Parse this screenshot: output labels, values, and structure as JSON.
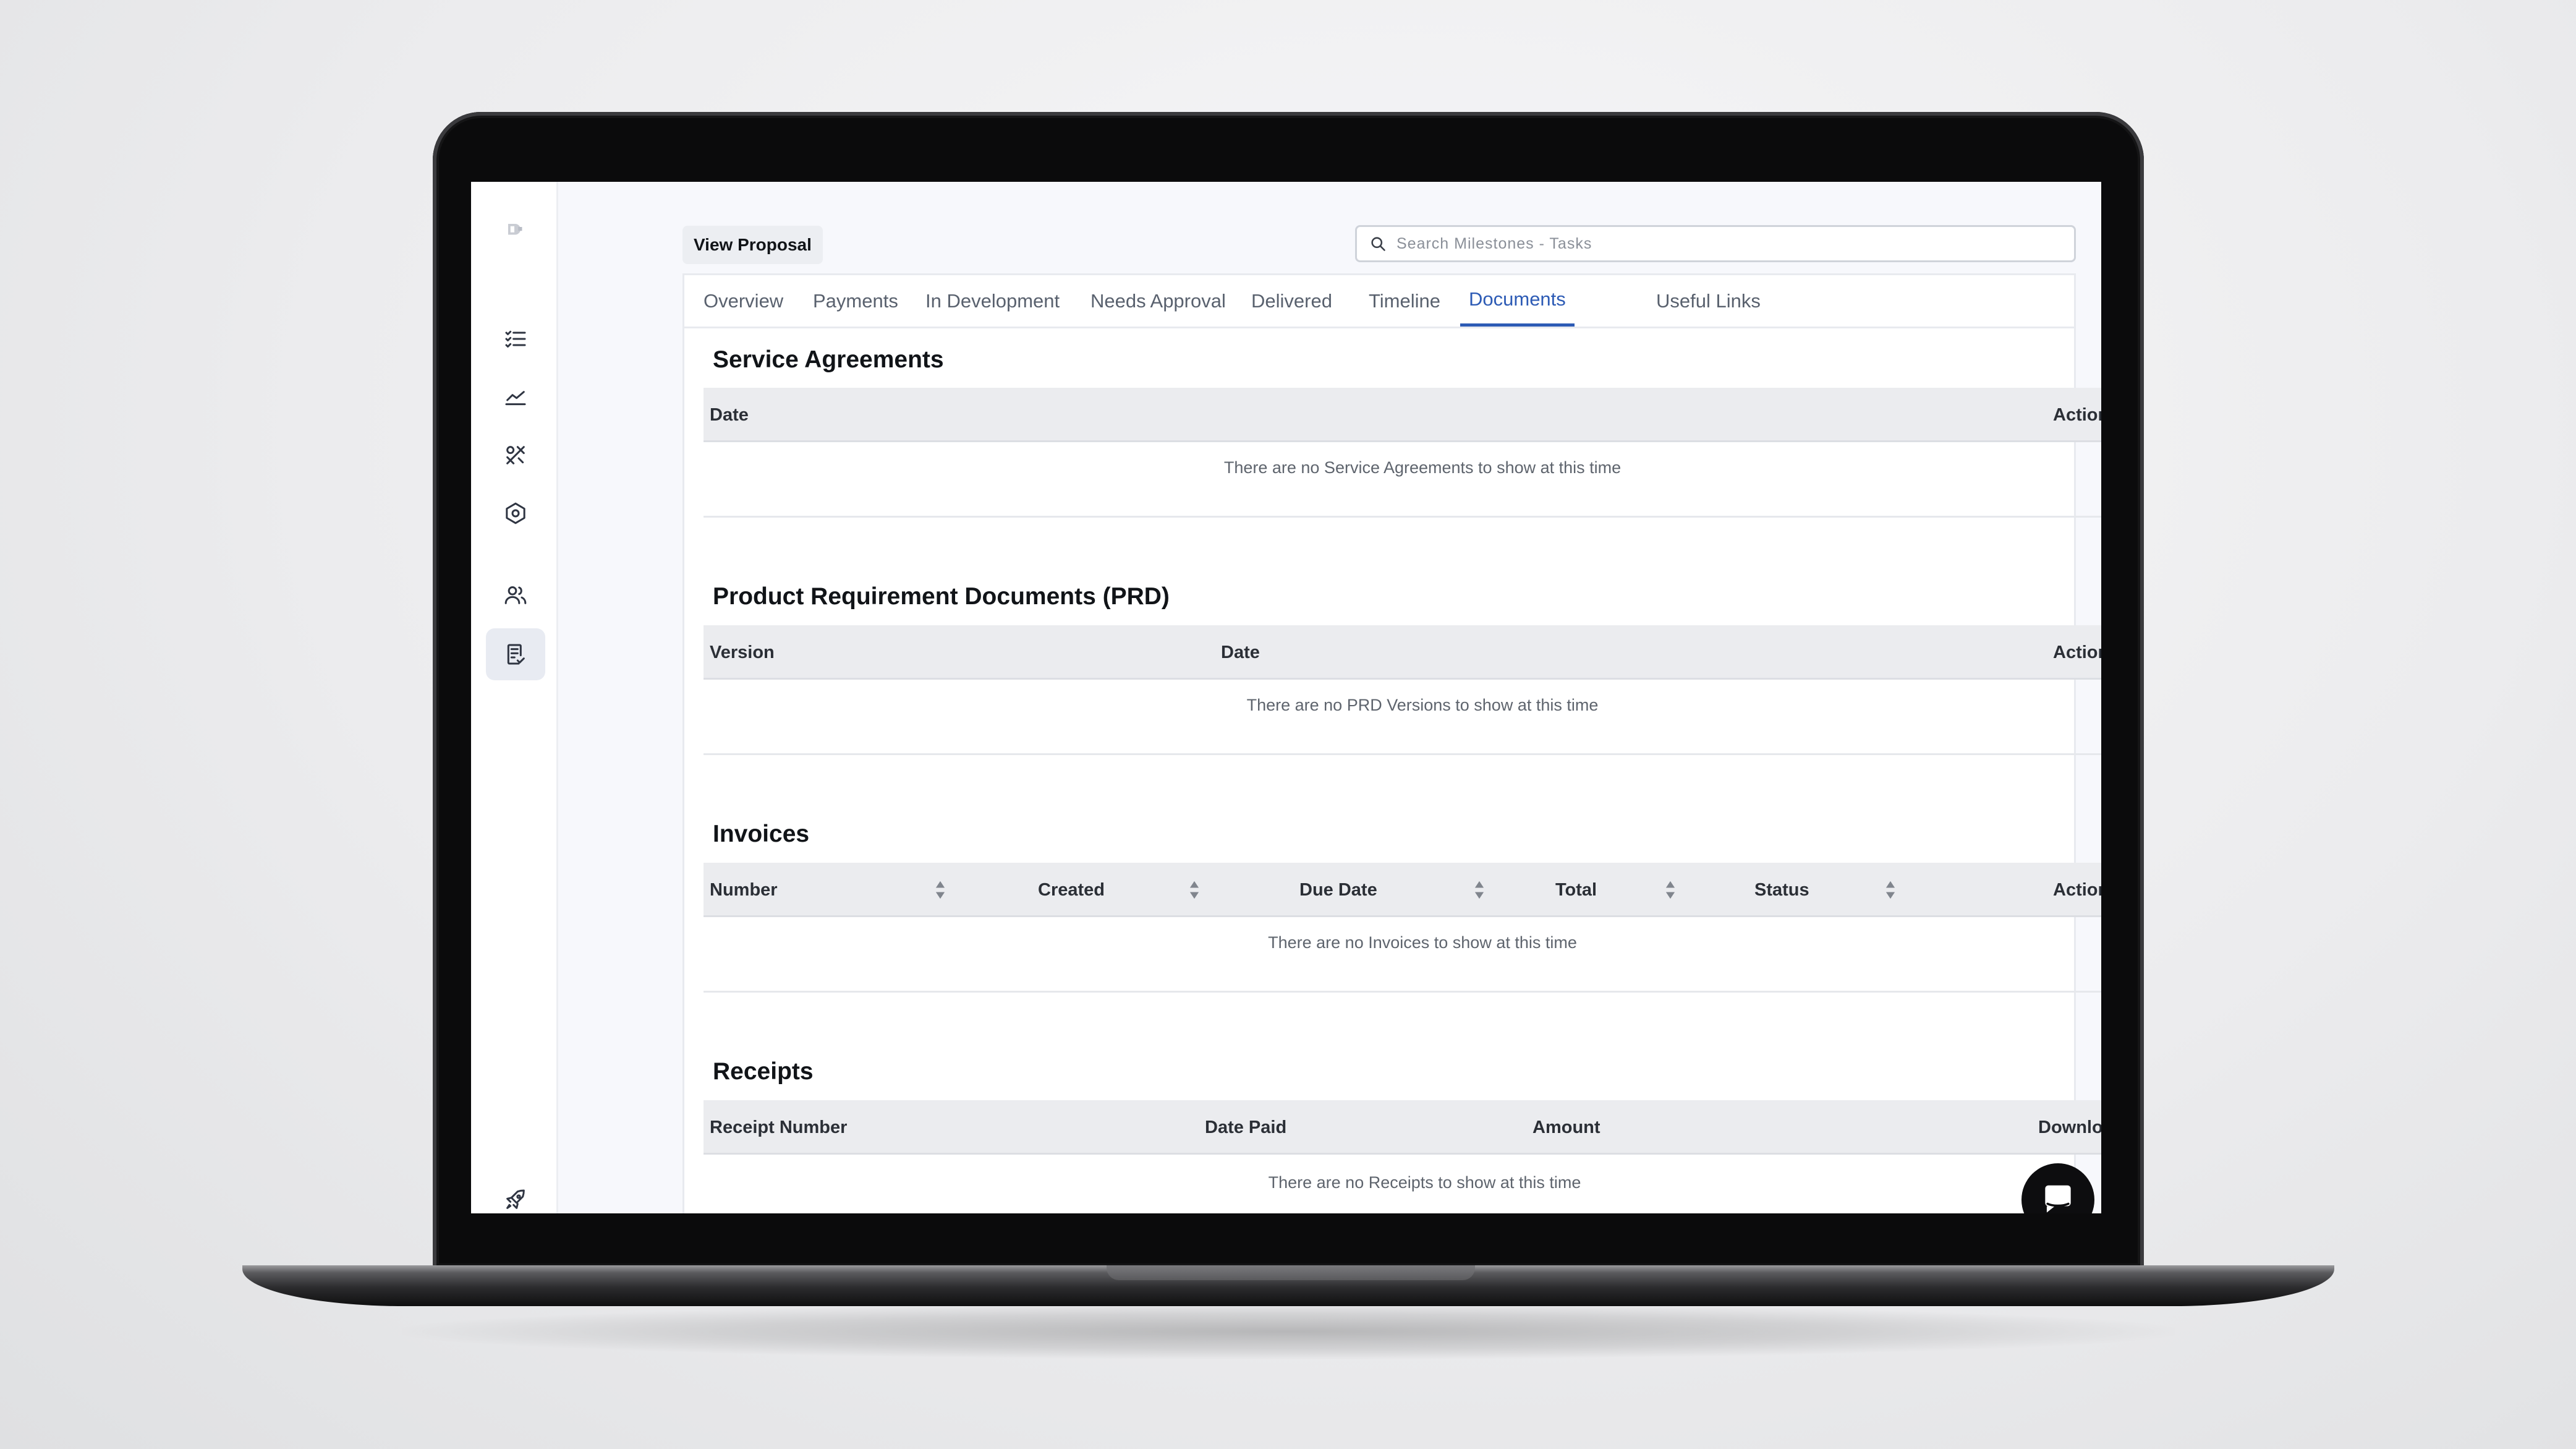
{
  "sidebar": {
    "items": [
      {
        "name": "logo-icon"
      },
      {
        "name": "task-list-icon"
      },
      {
        "name": "analytics-icon"
      },
      {
        "name": "design-tools-icon"
      },
      {
        "name": "settings-hex-icon"
      },
      {
        "name": "users-icon"
      },
      {
        "name": "documents-icon",
        "active": true
      },
      {
        "name": "rocket-icon"
      }
    ]
  },
  "header": {
    "view_proposal_label": "View Proposal",
    "search_placeholder": "Search Milestones - Tasks",
    "search_value": ""
  },
  "tabs": [
    {
      "label": "Overview"
    },
    {
      "label": "Payments"
    },
    {
      "label": "In Development"
    },
    {
      "label": "Needs Approval"
    },
    {
      "label": "Delivered"
    },
    {
      "label": "Timeline"
    },
    {
      "label": "Documents",
      "active": true
    },
    {
      "label": "Useful Links"
    }
  ],
  "sections": {
    "service_agreements": {
      "title": "Service Agreements",
      "columns": [
        "Date",
        "Action"
      ],
      "empty_message": "There are no Service Agreements to show at this time"
    },
    "prd": {
      "title": "Product Requirement Documents (PRD)",
      "columns": [
        "Version",
        "Date",
        "Action"
      ],
      "empty_message": "There are no PRD Versions to show at this time"
    },
    "invoices": {
      "title": "Invoices",
      "columns": [
        "Number",
        "Created",
        "Due Date",
        "Total",
        "Status",
        "Action"
      ],
      "empty_message": "There are no Invoices to show at this time"
    },
    "receipts": {
      "title": "Receipts",
      "columns": [
        "Receipt Number",
        "Date Paid",
        "Amount",
        "Download"
      ],
      "empty_message": "There are no Receipts to show at this time"
    }
  },
  "colors": {
    "accent": "#2d5bb5",
    "table_header_bg": "#ebecef",
    "page_bg": "#f7f8fc"
  }
}
